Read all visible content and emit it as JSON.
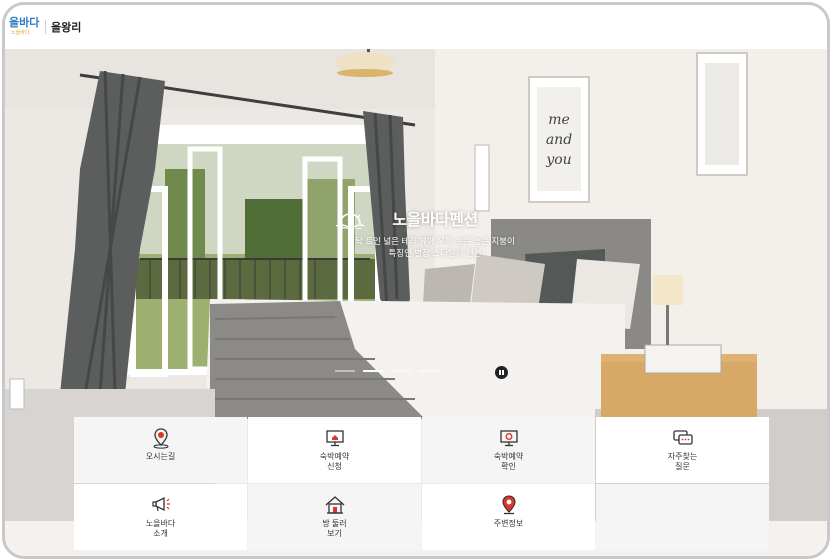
{
  "header": {
    "logo_text": "을바다",
    "logo_subtext": "노을바다",
    "site_title": "을왕리"
  },
  "hero": {
    "caption_title": "노을바다펜션",
    "caption_line1": "탁 트인 넓은 테라 뷰에 우뚝 솟은 높은 지붕이",
    "caption_line2": "특징인 별장 스타일의 펜션",
    "slide_count": 4,
    "active_slide": 2
  },
  "menu": {
    "items": [
      {
        "label": "오시는길",
        "icon": "map-pin-icon"
      },
      {
        "label": "숙박예약\n신청",
        "icon": "home-monitor-icon"
      },
      {
        "label": "숙박예약\n확인",
        "icon": "check-monitor-icon"
      },
      {
        "label": "자주찾는\n질문",
        "icon": "chat-bubble-icon"
      },
      {
        "label": "노을바다\n소개",
        "icon": "megaphone-icon"
      },
      {
        "label": "방 둘러\n보기",
        "icon": "house-icon"
      },
      {
        "label": "주변정보",
        "icon": "location-pin-icon"
      },
      {
        "label": "",
        "icon": ""
      }
    ]
  },
  "colors": {
    "accent_red": "#d9372b",
    "logo_blue": "#2f7bc4",
    "logo_orange": "#e0a52a"
  }
}
